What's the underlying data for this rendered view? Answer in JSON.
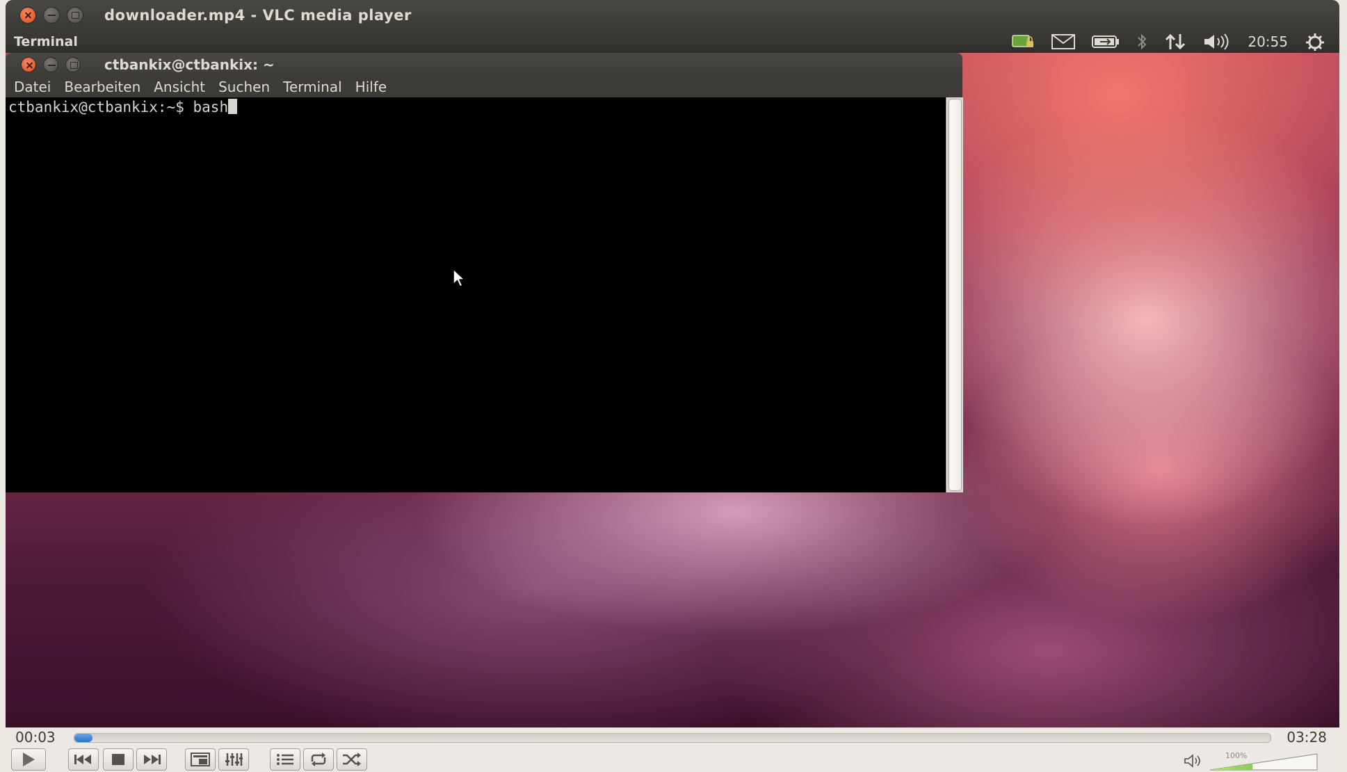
{
  "vlc": {
    "window_title": "downloader.mp4 - VLC media player",
    "elapsed": "00:03",
    "total": "03:28",
    "progress_fraction": 0.015,
    "volume_label": "100%",
    "volume_fraction": 0.4,
    "accent_color": "#2d74c4"
  },
  "panel": {
    "app_name": "Terminal",
    "clock": "20:55",
    "indicators": [
      "keyboard-lock-icon",
      "mail-icon",
      "battery-icon",
      "bluetooth-icon",
      "network-icon",
      "volume-icon",
      "session-gear-icon"
    ]
  },
  "terminal": {
    "title": "ctbankix@ctbankix: ~",
    "menu": [
      "Datei",
      "Bearbeiten",
      "Ansicht",
      "Suchen",
      "Terminal",
      "Hilfe"
    ],
    "prompt": "ctbankix@ctbankix:~$ ",
    "command": "bash"
  }
}
